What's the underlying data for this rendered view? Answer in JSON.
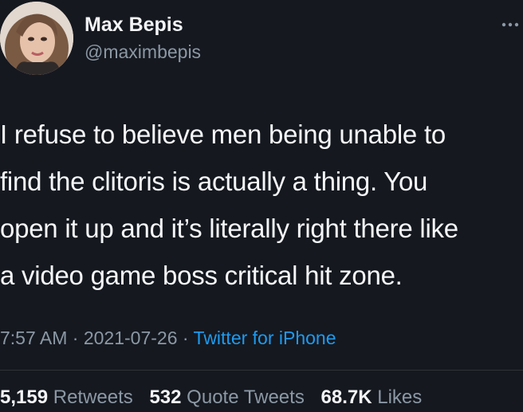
{
  "author": {
    "display_name": "Max Bepis",
    "handle": "@maximbepis"
  },
  "tweet": {
    "lines": [
      "I refuse to believe men being unable to",
      "find the clitoris is actually a thing. You",
      "open it up and it’s literally right there like",
      "a video game boss critical hit zone."
    ]
  },
  "meta": {
    "time": "7:57 AM",
    "separator": "·",
    "date": "2021-07-26",
    "source": "Twitter for iPhone"
  },
  "stats": {
    "retweets_count": "5,159",
    "retweets_label": "Retweets",
    "quotes_count": "532",
    "quotes_label": "Quote Tweets",
    "likes_count": "68.7K",
    "likes_label": "Likes"
  },
  "icons": {
    "more": "more-horizontal-icon"
  },
  "colors": {
    "background": "#15181f",
    "primary_text": "#f4f6f8",
    "secondary_text": "#8b98a5",
    "link": "#1d9bf0",
    "divider": "#2f3336"
  }
}
